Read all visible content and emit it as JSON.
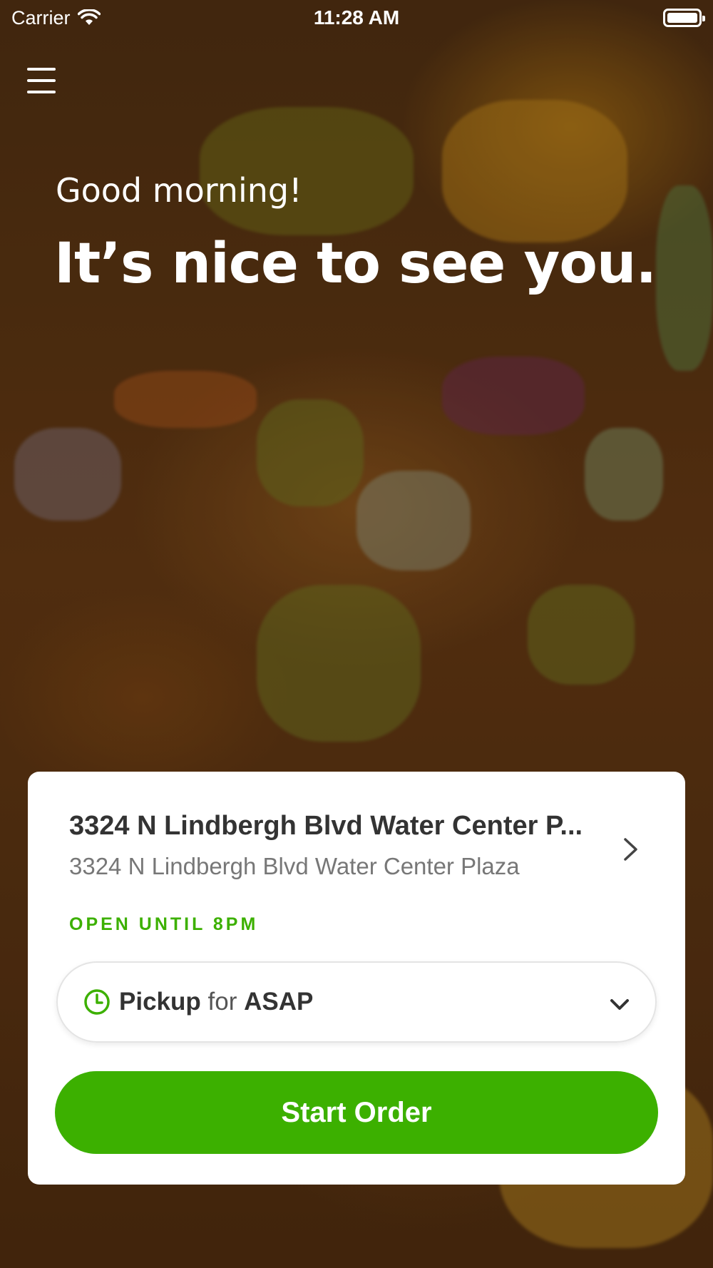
{
  "status_bar": {
    "carrier": "Carrier",
    "time": "11:28 AM"
  },
  "hero": {
    "greeting": "Good morning!",
    "headline": "It’s nice to see you."
  },
  "location_card": {
    "title": "3324 N Lindbergh Blvd Water Center P...",
    "address": "3324 N Lindbergh Blvd Water Center Plaza",
    "open_status": "OPEN UNTIL 8PM",
    "pickup": {
      "mode": "Pickup",
      "connector": "for",
      "time": "ASAP"
    },
    "start_button": "Start Order"
  },
  "colors": {
    "accent": "#3cb000",
    "card_background": "#ffffff",
    "title_text": "#333333",
    "secondary_text": "#777777"
  },
  "icons": {
    "menu": "hamburger-menu-icon",
    "wifi": "wifi-icon",
    "battery": "battery-icon",
    "clock": "clock-icon",
    "chevron_right": "chevron-right-icon",
    "chevron_down": "chevron-down-icon"
  }
}
